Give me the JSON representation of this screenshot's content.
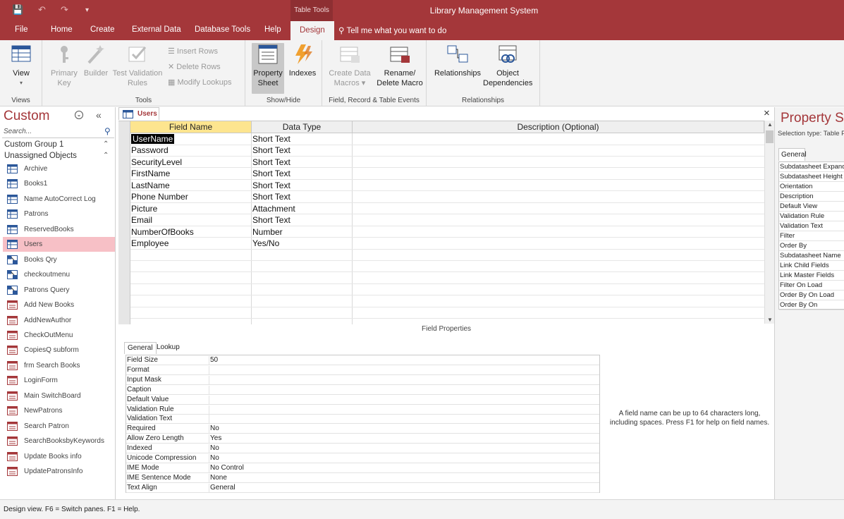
{
  "titlebar": {
    "title": "Library Management System",
    "context_group": "Table Tools",
    "qat": {
      "save": "💾",
      "undo": "↶",
      "redo": "↷",
      "customize": "▾"
    }
  },
  "tabs": [
    {
      "label": "File"
    },
    {
      "label": "Home"
    },
    {
      "label": "Create"
    },
    {
      "label": "External Data"
    },
    {
      "label": "Database Tools"
    },
    {
      "label": "Help"
    },
    {
      "label": "Design"
    }
  ],
  "tell_me": "Tell me what you want to do",
  "ribbon": {
    "views": {
      "label": "Views",
      "view_btn": "View",
      "view_arrow": "▾"
    },
    "tools": {
      "label": "Tools",
      "primary_key": "Primary\nKey",
      "builder": "Builder",
      "test_validation": "Test Validation\nRules",
      "insert_rows": "Insert Rows",
      "delete_rows": "Delete Rows",
      "modify_lookups": "Modify Lookups"
    },
    "showhide": {
      "label": "Show/Hide",
      "property_sheet": "Property\nSheet",
      "indexes": "Indexes"
    },
    "events": {
      "label": "Field, Record & Table Events",
      "create_data_macros": "Create Data\nMacros ▾",
      "rename_delete_macro": "Rename/\nDelete Macro"
    },
    "relationships": {
      "label": "Relationships",
      "relationships_btn": "Relationships",
      "object_dependencies": "Object\nDependencies"
    }
  },
  "nav": {
    "title": "Custom",
    "menu_icon": "⌄",
    "collapse_icon": "«",
    "search_placeholder": "Search...",
    "groups": [
      {
        "label": "Custom Group 1",
        "chev": "⌃"
      },
      {
        "label": "Unassigned Objects",
        "chev": "⌃"
      }
    ],
    "items": [
      {
        "label": "Archive",
        "kind": "table"
      },
      {
        "label": "Books1",
        "kind": "table"
      },
      {
        "label": "Name AutoCorrect Log",
        "kind": "table"
      },
      {
        "label": "Patrons",
        "kind": "table"
      },
      {
        "label": "ReservedBooks",
        "kind": "table"
      },
      {
        "label": "Users",
        "kind": "table",
        "selected": true
      },
      {
        "label": "Books Qry",
        "kind": "query"
      },
      {
        "label": "checkoutmenu",
        "kind": "query"
      },
      {
        "label": "Patrons Query",
        "kind": "query"
      },
      {
        "label": "Add New Books",
        "kind": "form"
      },
      {
        "label": "AddNewAuthor",
        "kind": "form"
      },
      {
        "label": "CheckOutMenu",
        "kind": "form"
      },
      {
        "label": "CopiesQ subform",
        "kind": "form"
      },
      {
        "label": "frm Search Books",
        "kind": "form"
      },
      {
        "label": "LoginForm",
        "kind": "form"
      },
      {
        "label": "Main SwitchBoard",
        "kind": "form"
      },
      {
        "label": "NewPatrons",
        "kind": "form"
      },
      {
        "label": "Search Patron",
        "kind": "form"
      },
      {
        "label": "SearchBooksbyKeywords",
        "kind": "form"
      },
      {
        "label": "Update Books info",
        "kind": "form"
      },
      {
        "label": "UpdatePatronsInfo",
        "kind": "form"
      }
    ]
  },
  "doc": {
    "tab_label": "Users",
    "close": "×",
    "columns": {
      "field_name": "Field Name",
      "data_type": "Data Type",
      "description": "Description (Optional)"
    },
    "rows": [
      {
        "field": "UserName",
        "type": "Short Text"
      },
      {
        "field": "Password",
        "type": "Short Text"
      },
      {
        "field": "SecurityLevel",
        "type": "Short Text"
      },
      {
        "field": "FirstName",
        "type": "Short Text"
      },
      {
        "field": "LastName",
        "type": "Short Text"
      },
      {
        "field": "Phone Number",
        "type": "Short Text"
      },
      {
        "field": "Picture",
        "type": "Attachment"
      },
      {
        "field": "Email",
        "type": "Short Text"
      },
      {
        "field": "NumberOfBooks",
        "type": "Number"
      },
      {
        "field": "Employee",
        "type": "Yes/No"
      }
    ],
    "field_properties_label": "Field Properties",
    "prop_tabs": [
      "General",
      "Lookup"
    ],
    "properties": [
      {
        "name": "Field Size",
        "value": "50"
      },
      {
        "name": "Format",
        "value": ""
      },
      {
        "name": "Input Mask",
        "value": ""
      },
      {
        "name": "Caption",
        "value": ""
      },
      {
        "name": "Default Value",
        "value": ""
      },
      {
        "name": "Validation Rule",
        "value": ""
      },
      {
        "name": "Validation Text",
        "value": ""
      },
      {
        "name": "Required",
        "value": "No"
      },
      {
        "name": "Allow Zero Length",
        "value": "Yes"
      },
      {
        "name": "Indexed",
        "value": "No"
      },
      {
        "name": "Unicode Compression",
        "value": "No"
      },
      {
        "name": "IME Mode",
        "value": "No Control"
      },
      {
        "name": "IME Sentence Mode",
        "value": "None"
      },
      {
        "name": "Text Align",
        "value": "General"
      }
    ],
    "help_text": "A field name can be up to 64 characters long, including spaces. Press F1 for help on field names."
  },
  "property_sheet": {
    "title": "Property Sh",
    "selection_type": "Selection type: Table P",
    "tab": "General",
    "rows": [
      "Subdatasheet Expand",
      "Subdatasheet Height",
      "Orientation",
      "Description",
      "Default View",
      "Validation Rule",
      "Validation Text",
      "Filter",
      "Order By",
      "Subdatasheet Name",
      "Link Child Fields",
      "Link Master Fields",
      "Filter On Load",
      "Order By On Load",
      "Order By On"
    ]
  },
  "status": "Design view.  F6 = Switch panes.  F1 = Help.",
  "colors": {
    "accent": "#a4373a",
    "selected_nav": "#f7c0c6",
    "active_header": "#fde58f"
  }
}
